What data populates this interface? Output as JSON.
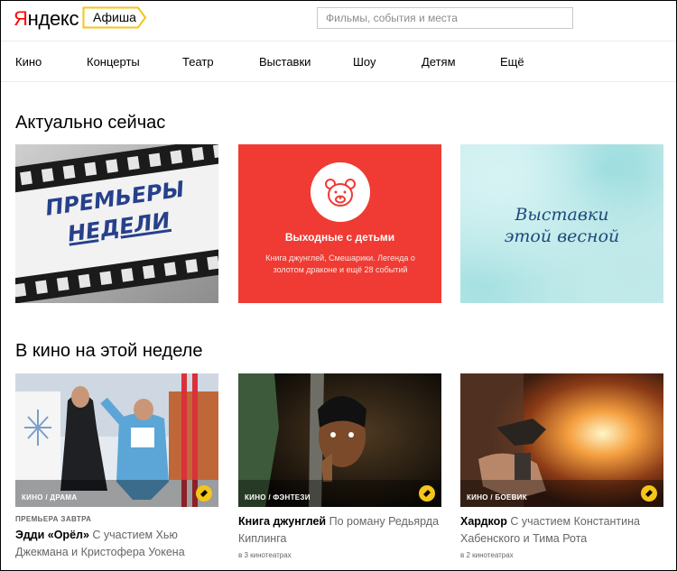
{
  "header": {
    "logo": "Яндекс",
    "logo_first_letter": "Я",
    "logo_rest": "ндекс",
    "service": "Афиша",
    "search_placeholder": "Фильмы, события и места"
  },
  "nav": {
    "items": [
      "Кино",
      "Концерты",
      "Театр",
      "Выставки",
      "Шоу",
      "Детям",
      "Ещё"
    ]
  },
  "actual": {
    "title": "Актуально сейчас",
    "cards": [
      {
        "lines": [
          "ПРЕМЬЕРЫ",
          "НЕДЕЛИ"
        ],
        "icon": "film-strip-icon"
      },
      {
        "title": "Выходные с детьми",
        "subtitle": "Книга джунглей, Смешарики. Легенда о золотом драконе и ещё 28 событий",
        "icon": "bear-face-icon"
      },
      {
        "lines": [
          "Выставки",
          "этой весной"
        ]
      }
    ]
  },
  "movies": {
    "title": "В кино на этой неделе",
    "items": [
      {
        "genre": "КИНО / ДРАМА",
        "badge": "ПРЕМЬЕРА ЗАВТРА",
        "name": "Эдди «Орёл»",
        "desc": "С участием Хью Джекмана и Кристофера Уокена",
        "cinemas": ""
      },
      {
        "genre": "КИНО / ФЭНТЕЗИ",
        "badge": "",
        "name": "Книга джунглей",
        "desc": "По роману Редьярда Киплинга",
        "cinemas": "в 3 кинотеатрах"
      },
      {
        "genre": "КИНО / БОЕВИК",
        "badge": "",
        "name": "Хардкор",
        "desc": "С участием Константина Хабенского и Тима Рота",
        "cinemas": "в 2 кинотеатрах"
      }
    ]
  },
  "colors": {
    "logo_red": "#ff0000",
    "service_tag_border": "#f5c518",
    "kids_red": "#ef3b33",
    "ticket_yellow": "#f5c518",
    "exhibition_text": "#1d4a7a"
  }
}
